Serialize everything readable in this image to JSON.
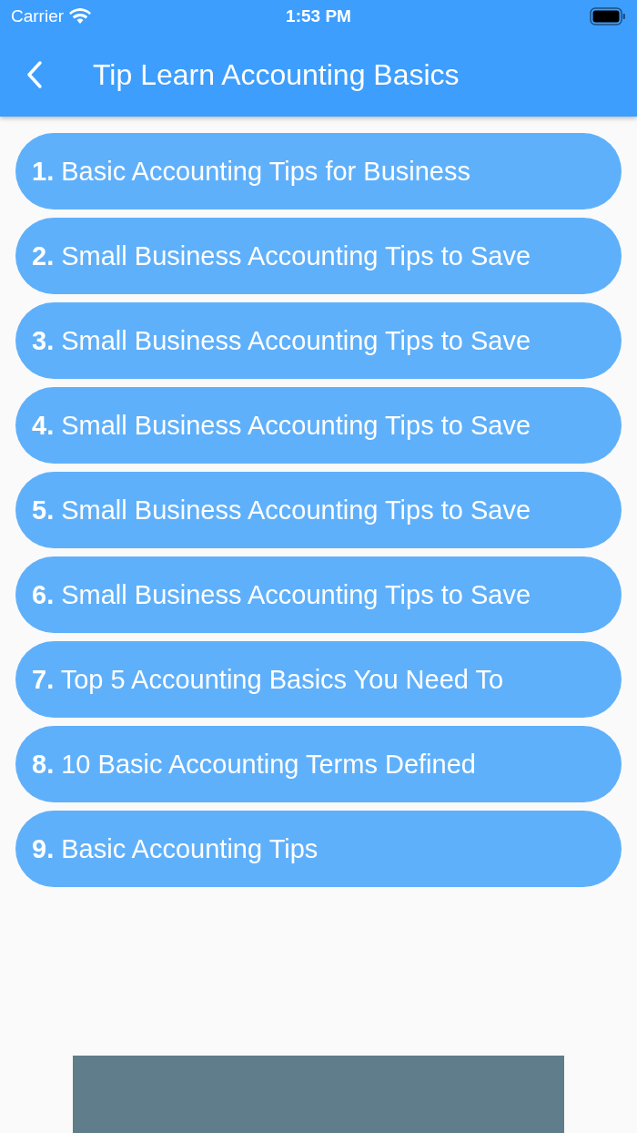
{
  "status_bar": {
    "carrier": "Carrier",
    "time": "1:53 PM"
  },
  "header": {
    "title": "Tip Learn Accounting Basics"
  },
  "items": [
    {
      "number": "1.",
      "title": "Basic Accounting Tips for Business"
    },
    {
      "number": "2.",
      "title": "Small Business Accounting Tips to Save"
    },
    {
      "number": "3.",
      "title": "Small Business Accounting Tips to Save"
    },
    {
      "number": "4.",
      "title": "Small Business Accounting Tips to Save"
    },
    {
      "number": "5.",
      "title": "Small Business Accounting Tips to Save"
    },
    {
      "number": "6.",
      "title": "Small Business Accounting Tips to Save"
    },
    {
      "number": "7.",
      "title": "Top 5 Accounting Basics You Need To"
    },
    {
      "number": "8.",
      "title": "10 Basic Accounting Terms Defined"
    },
    {
      "number": "9.",
      "title": "Basic Accounting Tips"
    }
  ]
}
